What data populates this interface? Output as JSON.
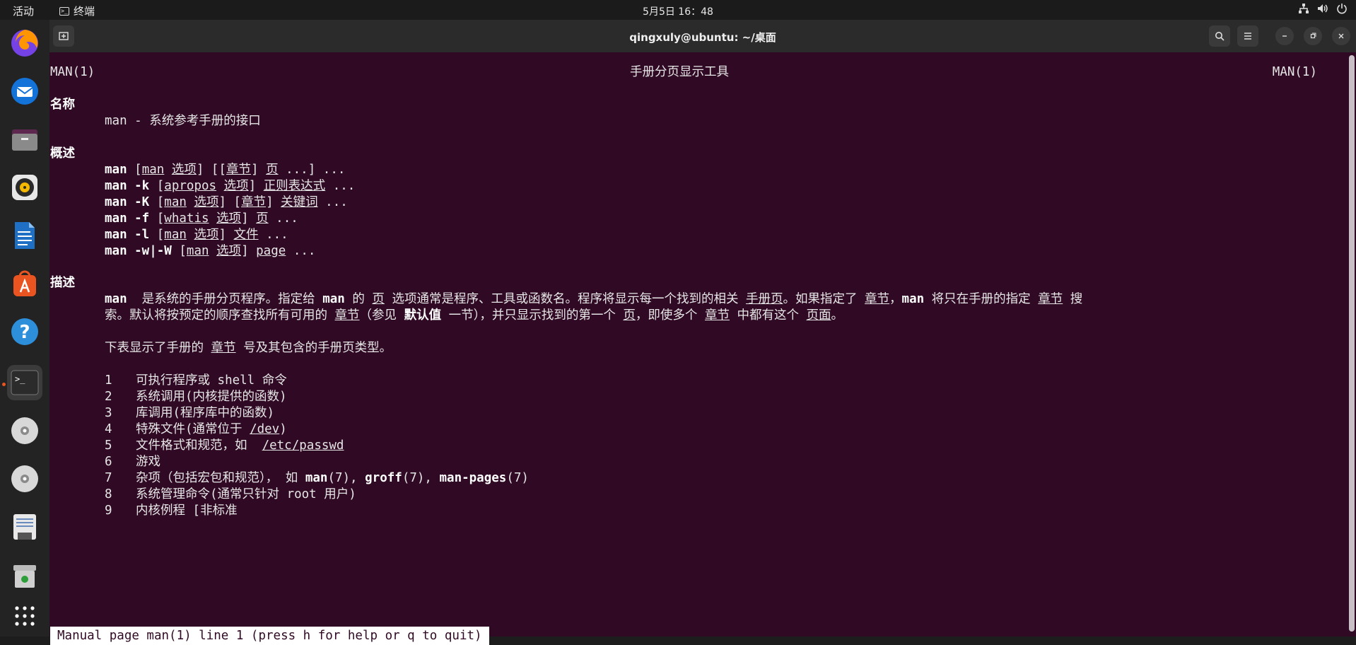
{
  "topbar": {
    "activities": "活动",
    "app_name": "终端",
    "clock": "5月5日  16：48",
    "network_icon": "network-icon",
    "volume_icon": "volume-icon",
    "power_icon": "power-icon"
  },
  "dock": {
    "items": [
      "firefox-icon",
      "thunderbird-icon",
      "files-icon",
      "rhythmbox-icon",
      "writer-icon",
      "app-center-icon",
      "help-icon",
      "terminal-icon",
      "disc-icon",
      "disc-icon",
      "text-editor-icon",
      "trash-icon",
      "apps-grid-icon"
    ]
  },
  "window": {
    "title": "qingxuly@ubuntu: ~/桌面"
  },
  "man": {
    "header_left": "MAN(1)",
    "header_center": "手册分页显示工具",
    "header_right": "MAN(1)",
    "sec_name": "名称",
    "name_line": "man - 系统参考手册的接口",
    "sec_synopsis": "概述",
    "syn": [
      {
        "cmd": "man",
        "opt": "",
        "rest": [
          " [",
          "man",
          " ",
          "选项",
          "] [[",
          "章节",
          "] ",
          "页",
          " ...] ..."
        ]
      },
      {
        "cmd": "man -k",
        "opt": "",
        "rest": [
          " [",
          "apropos",
          " ",
          "选项",
          "] ",
          "正则表达式",
          " ..."
        ]
      },
      {
        "cmd": "man -K",
        "opt": "",
        "rest": [
          " [",
          "man",
          " ",
          "选项",
          "] [",
          "章节",
          "] ",
          "关键词",
          " ..."
        ]
      },
      {
        "cmd": "man -f",
        "opt": "",
        "rest": [
          " [",
          "whatis",
          " ",
          "选项",
          "] ",
          "页",
          " ..."
        ]
      },
      {
        "cmd": "man -l",
        "opt": "",
        "rest": [
          " [",
          "man",
          " ",
          "选项",
          "] ",
          "文件",
          " ..."
        ]
      },
      {
        "cmd": "man -w|-W",
        "opt": "",
        "rest": [
          " [",
          "man",
          " ",
          "选项",
          "] ",
          "page",
          " ..."
        ]
      }
    ],
    "sec_desc": "描述",
    "desc1": [
      "man",
      "  是系统的手册分页程序。指定给 ",
      "man",
      " 的 ",
      "页",
      " 选项通常是程序、工具或函数名。程序将显示每一个找到的相关 ",
      "手册页",
      "。如果指定了 ",
      "章节",
      "，",
      "man",
      " 将只在手册的指定 ",
      "章节",
      " 搜"
    ],
    "desc2": [
      "索。默认将按预定的顺序查找所有可用的 ",
      "章节",
      "（参见 ",
      "默认值",
      " 一节），并只显示找到的第一个 ",
      "页",
      "，即使多个 ",
      "章节",
      " 中都有这个 ",
      "页面",
      "。"
    ],
    "table_intro": [
      "下表显示了手册的 ",
      "章节",
      " 号及其包含的手册页类型。"
    ],
    "sections": [
      {
        "n": "1",
        "text": [
          "可执行程序或 shell 命令"
        ]
      },
      {
        "n": "2",
        "text": [
          "系统调用(内核提供的函数)"
        ]
      },
      {
        "n": "3",
        "text": [
          "库调用(程序库中的函数)"
        ]
      },
      {
        "n": "4",
        "text": [
          "特殊文件(通常位于 ",
          "/dev",
          ")"
        ]
      },
      {
        "n": "5",
        "text": [
          "文件格式和规范，如  ",
          "/etc/passwd",
          ""
        ]
      },
      {
        "n": "6",
        "text": [
          "游戏"
        ]
      },
      {
        "n": "7",
        "text": [
          "杂项（包括宏包和规范）， 如 ",
          "man",
          "(7), ",
          "groff",
          "(7), ",
          "man-pages",
          "(7)"
        ]
      },
      {
        "n": "8",
        "text": [
          "系统管理命令(通常只针对 root 用户)"
        ]
      },
      {
        "n": "9",
        "text": [
          "内核例程 [非标准"
        ]
      }
    ],
    "status": "Manual page man(1) line 1 (press h for help or q to quit)"
  }
}
